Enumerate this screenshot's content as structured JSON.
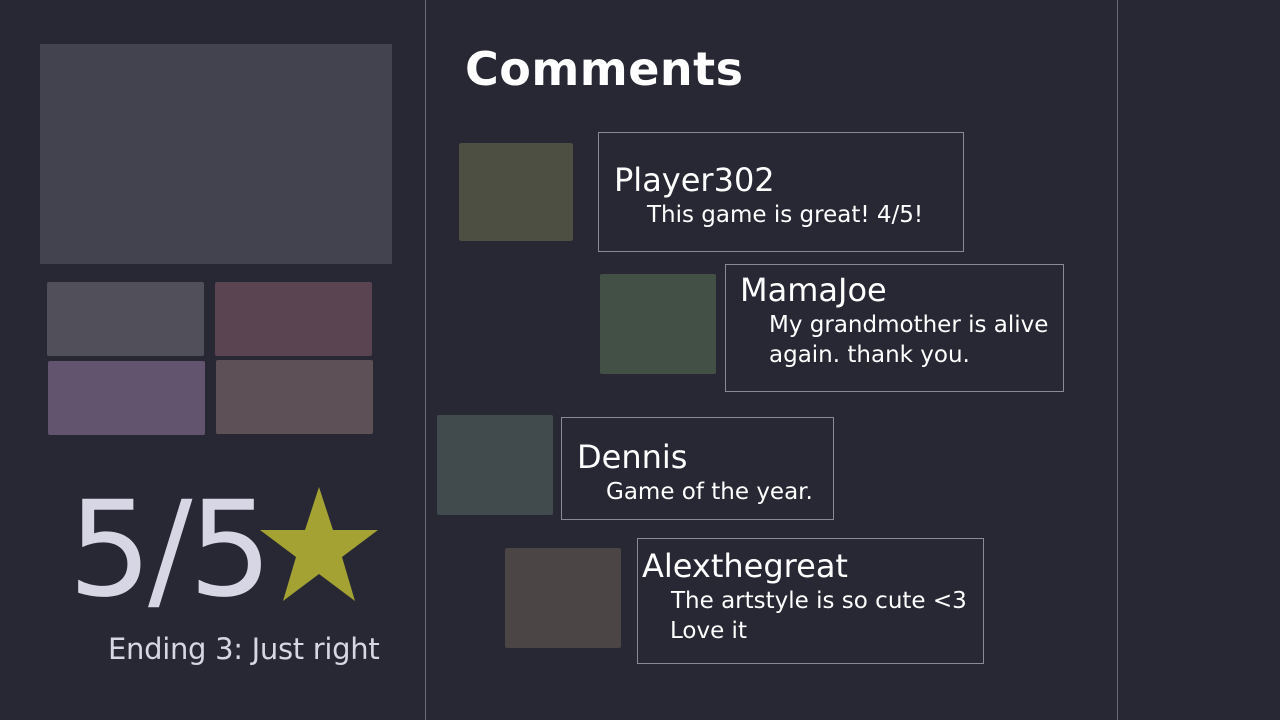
{
  "colors": {
    "background": "#282834",
    "text_light": "#d7d6e4",
    "text_white": "#ffffff",
    "star": "#a3a233"
  },
  "gallery": {
    "main_color": "#43434f",
    "tiles": [
      {
        "color": "#51505a"
      },
      {
        "color": "#5a4451"
      },
      {
        "color": "#62536f"
      },
      {
        "color": "#5d5057"
      }
    ]
  },
  "rating": {
    "score": "5/5",
    "icon": "star-icon",
    "ending_label": "Ending 3: Just right"
  },
  "comments": {
    "title": "Comments",
    "items": [
      {
        "username": "Player302",
        "text": "This game is great! 4/5!",
        "avatar_color": "#4c4f41"
      },
      {
        "username": "MamaJoe",
        "text": "My grandmother is alive",
        "text2": "again. thank you.",
        "avatar_color": "#435045"
      },
      {
        "username": "Dennis",
        "text": "Game of the year.",
        "avatar_color": "#414a4c"
      },
      {
        "username": "Alexthegreat",
        "text": "The artstyle is so cute <3",
        "text2": "Love it",
        "avatar_color": "#4c4546"
      }
    ]
  }
}
